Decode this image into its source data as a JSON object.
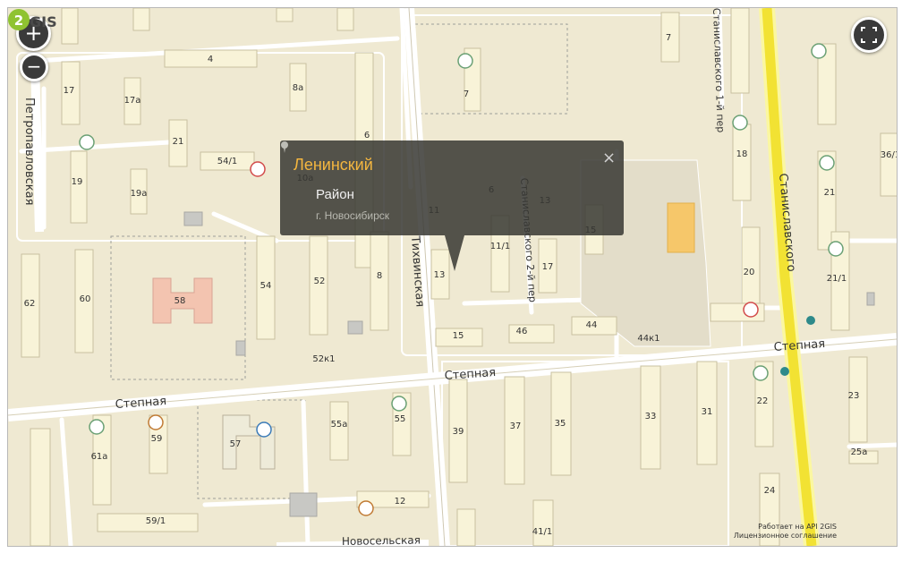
{
  "controls": {
    "zoom_in": "+",
    "zoom_out": "−"
  },
  "popup": {
    "title": "Ленинский",
    "type": "Район",
    "city": "г. Новосибирск",
    "close": "×"
  },
  "streets": {
    "petropavlovskaya": "Петропавловская",
    "tikhvinskaya": "Тихвинская",
    "stepnaya": "Степная",
    "stanislavskogo": "Станиславского",
    "stanislavskogo_1": "Станиславского 1-й пер",
    "stanislavskogo_2": "Станиславского 2-й пер",
    "novoselskaya": "Новосельская"
  },
  "buildings": [
    "7",
    "4",
    "17",
    "17a",
    "8a",
    "6",
    "21",
    "54/1",
    "19",
    "19a",
    "10a",
    "11",
    "6",
    "13",
    "7",
    "36/1",
    "18",
    "21",
    "21/1",
    "62",
    "60",
    "58",
    "54",
    "52",
    "8",
    "13",
    "11/1",
    "17",
    "15",
    "20",
    "46",
    "44",
    "44к1",
    "52к1",
    "15",
    "23",
    "22",
    "61a",
    "59",
    "57",
    "55a",
    "55",
    "39",
    "37",
    "35",
    "33",
    "31",
    "25a",
    "12",
    "59/1",
    "41/1",
    "24",
    "7"
  ],
  "credits": {
    "line1": "Работает на API 2GIS",
    "line2": "Лицензионное соглашение",
    "logo": "2GIS"
  },
  "colors": {
    "background": "#efe9d2",
    "building": "#f8f3d8",
    "major_road": "#f5e83a",
    "popup_title": "#f4b63f",
    "logo_green": "#8fc331"
  }
}
